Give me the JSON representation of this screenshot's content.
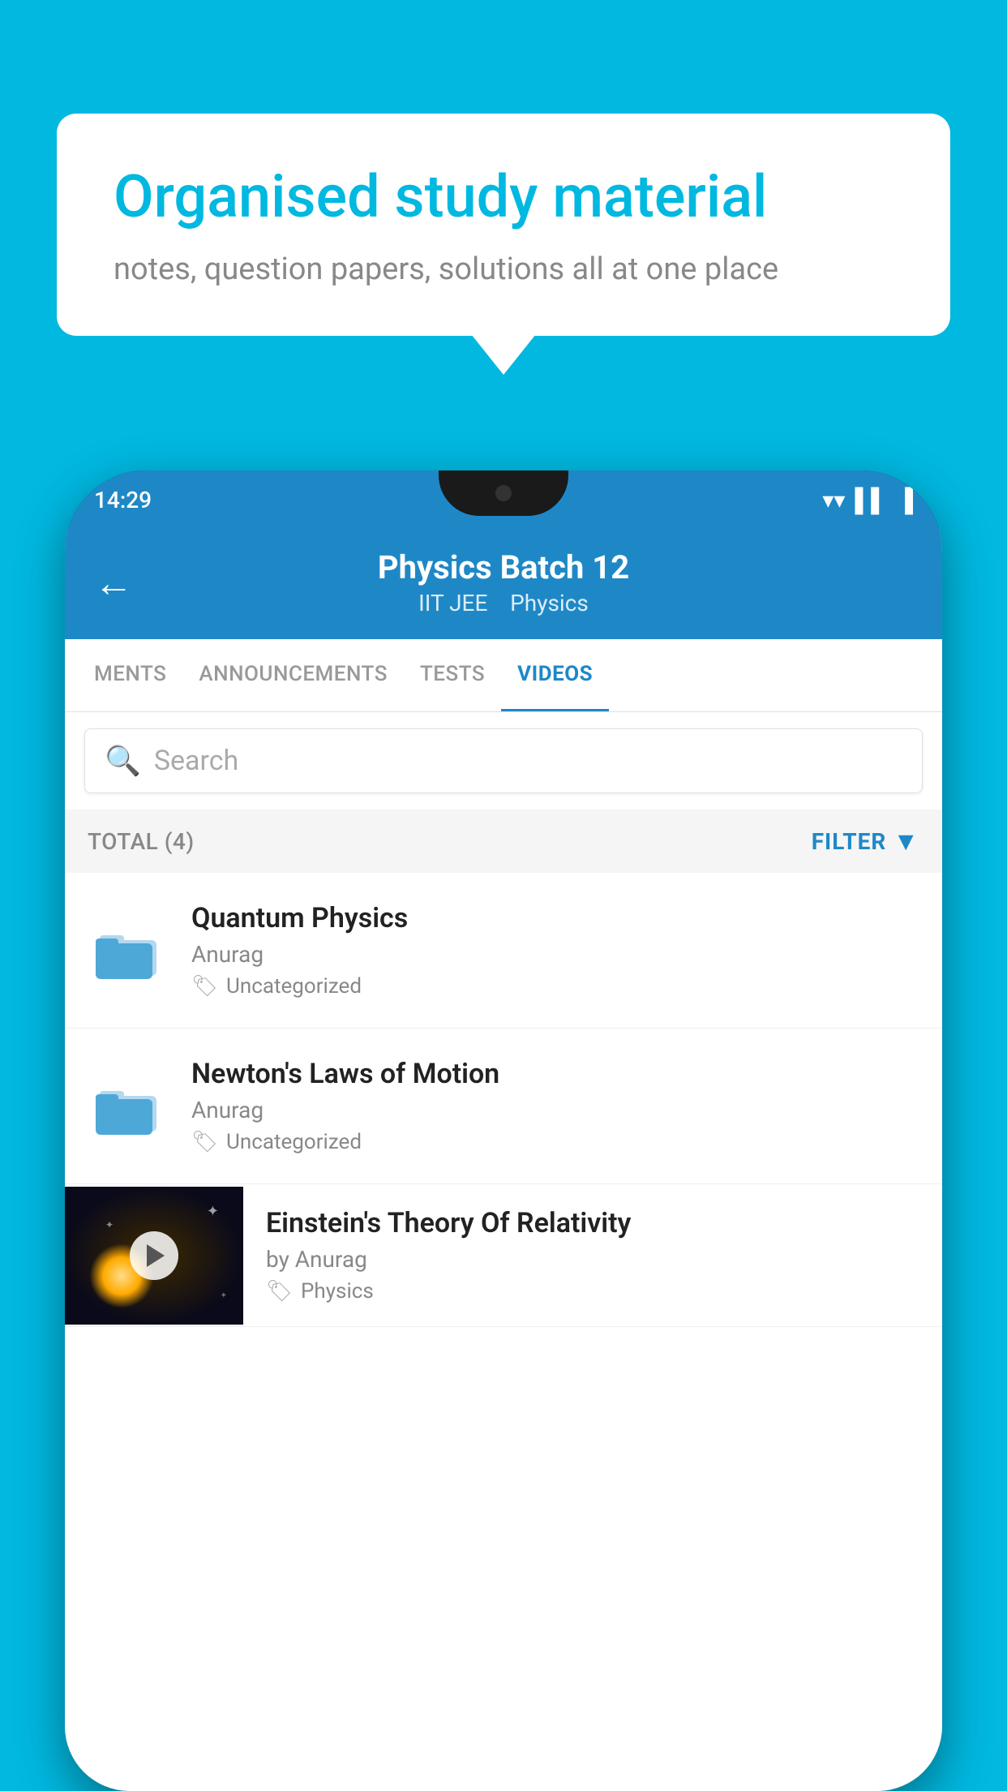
{
  "background_color": "#00b8e0",
  "bubble": {
    "title": "Organised study material",
    "subtitle": "notes, question papers, solutions all at one place"
  },
  "status_bar": {
    "time": "14:29",
    "icons": [
      "wifi",
      "signal",
      "battery"
    ]
  },
  "header": {
    "back_label": "←",
    "title": "Physics Batch 12",
    "subtitle_parts": [
      "IIT JEE",
      "Physics"
    ]
  },
  "tabs": [
    {
      "label": "MENTS",
      "active": false
    },
    {
      "label": "ANNOUNCEMENTS",
      "active": false
    },
    {
      "label": "TESTS",
      "active": false
    },
    {
      "label": "VIDEOS",
      "active": true
    }
  ],
  "search": {
    "placeholder": "Search"
  },
  "filter_bar": {
    "total_label": "TOTAL (4)",
    "filter_label": "FILTER"
  },
  "videos": [
    {
      "title": "Quantum Physics",
      "author": "Anurag",
      "tag": "Uncategorized",
      "has_thumbnail": false
    },
    {
      "title": "Newton's Laws of Motion",
      "author": "Anurag",
      "tag": "Uncategorized",
      "has_thumbnail": false
    },
    {
      "title": "Einstein's Theory Of Relativity",
      "author": "by Anurag",
      "tag": "Physics",
      "has_thumbnail": true
    }
  ],
  "icons": {
    "search": "🔍",
    "tag": "🏷",
    "filter_funnel": "▼"
  }
}
